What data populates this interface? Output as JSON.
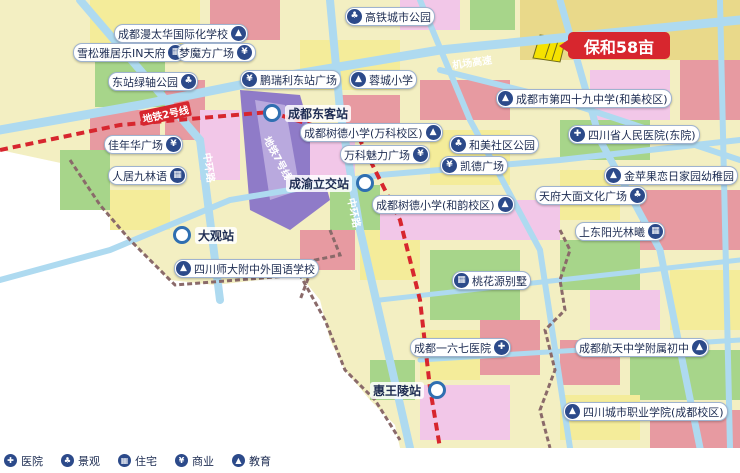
{
  "plot_tag": "保和58亩",
  "roads": {
    "airport_expressway": "机场高速",
    "metro_line2": "地铁2号线",
    "inner_ring": "中环路",
    "inner_ring2": "中环路",
    "metro_line7": "地铁7号线"
  },
  "stations": [
    {
      "name": "成都东客站"
    },
    {
      "name": "成渝立交站"
    },
    {
      "name": "大观站"
    },
    {
      "name": "惠王陵站"
    }
  ],
  "pois": [
    {
      "name": "高铁城市公园",
      "category": "landscape"
    },
    {
      "name": "成都漫太华国际化学校",
      "category": "education"
    },
    {
      "name": "雪松雅居乐IN天府",
      "category": "residential"
    },
    {
      "name": "梦魔方广场",
      "category": "commercial"
    },
    {
      "name": "东站绿轴公园",
      "category": "landscape"
    },
    {
      "name": "鹏瑞利东站广场",
      "category": "commercial"
    },
    {
      "name": "蓉城小学",
      "category": "education"
    },
    {
      "name": "成都市第四十九中学(和美校区)",
      "category": "education"
    },
    {
      "name": "成都树德小学(万科校区)",
      "category": "education"
    },
    {
      "name": "四川省人民医院(东院)",
      "category": "hospital"
    },
    {
      "name": "佳年华广场",
      "category": "commercial"
    },
    {
      "name": "和美社区公园",
      "category": "landscape"
    },
    {
      "name": "万科魅力广场",
      "category": "commercial"
    },
    {
      "name": "凯德广场",
      "category": "commercial"
    },
    {
      "name": "金苹果恋日家园幼稚园",
      "category": "education"
    },
    {
      "name": "人居九林语",
      "category": "residential"
    },
    {
      "name": "天府大面文化广场",
      "category": "landscape"
    },
    {
      "name": "成都树德小学(和韵校区)",
      "category": "education"
    },
    {
      "name": "上东阳光林曦",
      "category": "residential"
    },
    {
      "name": "四川师大附中外国语学校",
      "category": "education"
    },
    {
      "name": "桃花源别墅",
      "category": "residential"
    },
    {
      "name": "成都一六七医院",
      "category": "hospital"
    },
    {
      "name": "成都航天中学附属初中",
      "category": "education"
    },
    {
      "name": "四川城市职业学院(成都校区)",
      "category": "education"
    }
  ],
  "legend": [
    {
      "label": "医院",
      "icon": "hospital-icon"
    },
    {
      "label": "景观",
      "icon": "landscape-icon"
    },
    {
      "label": "住宅",
      "icon": "residential-icon"
    },
    {
      "label": "商业",
      "icon": "commercial-icon"
    },
    {
      "label": "教育",
      "icon": "education-icon"
    }
  ],
  "colors": {
    "residential": "#f4ec9a",
    "commercial": "#e79aa1",
    "green": "#a7d58a",
    "education": "#f2c7e8",
    "industrial": "#b9a9de",
    "road": "#aedaf0",
    "metro": "#d7262e",
    "tag": "#d7262e",
    "icon": "#2c4a8a",
    "station_ring": "#2f6fb1"
  }
}
